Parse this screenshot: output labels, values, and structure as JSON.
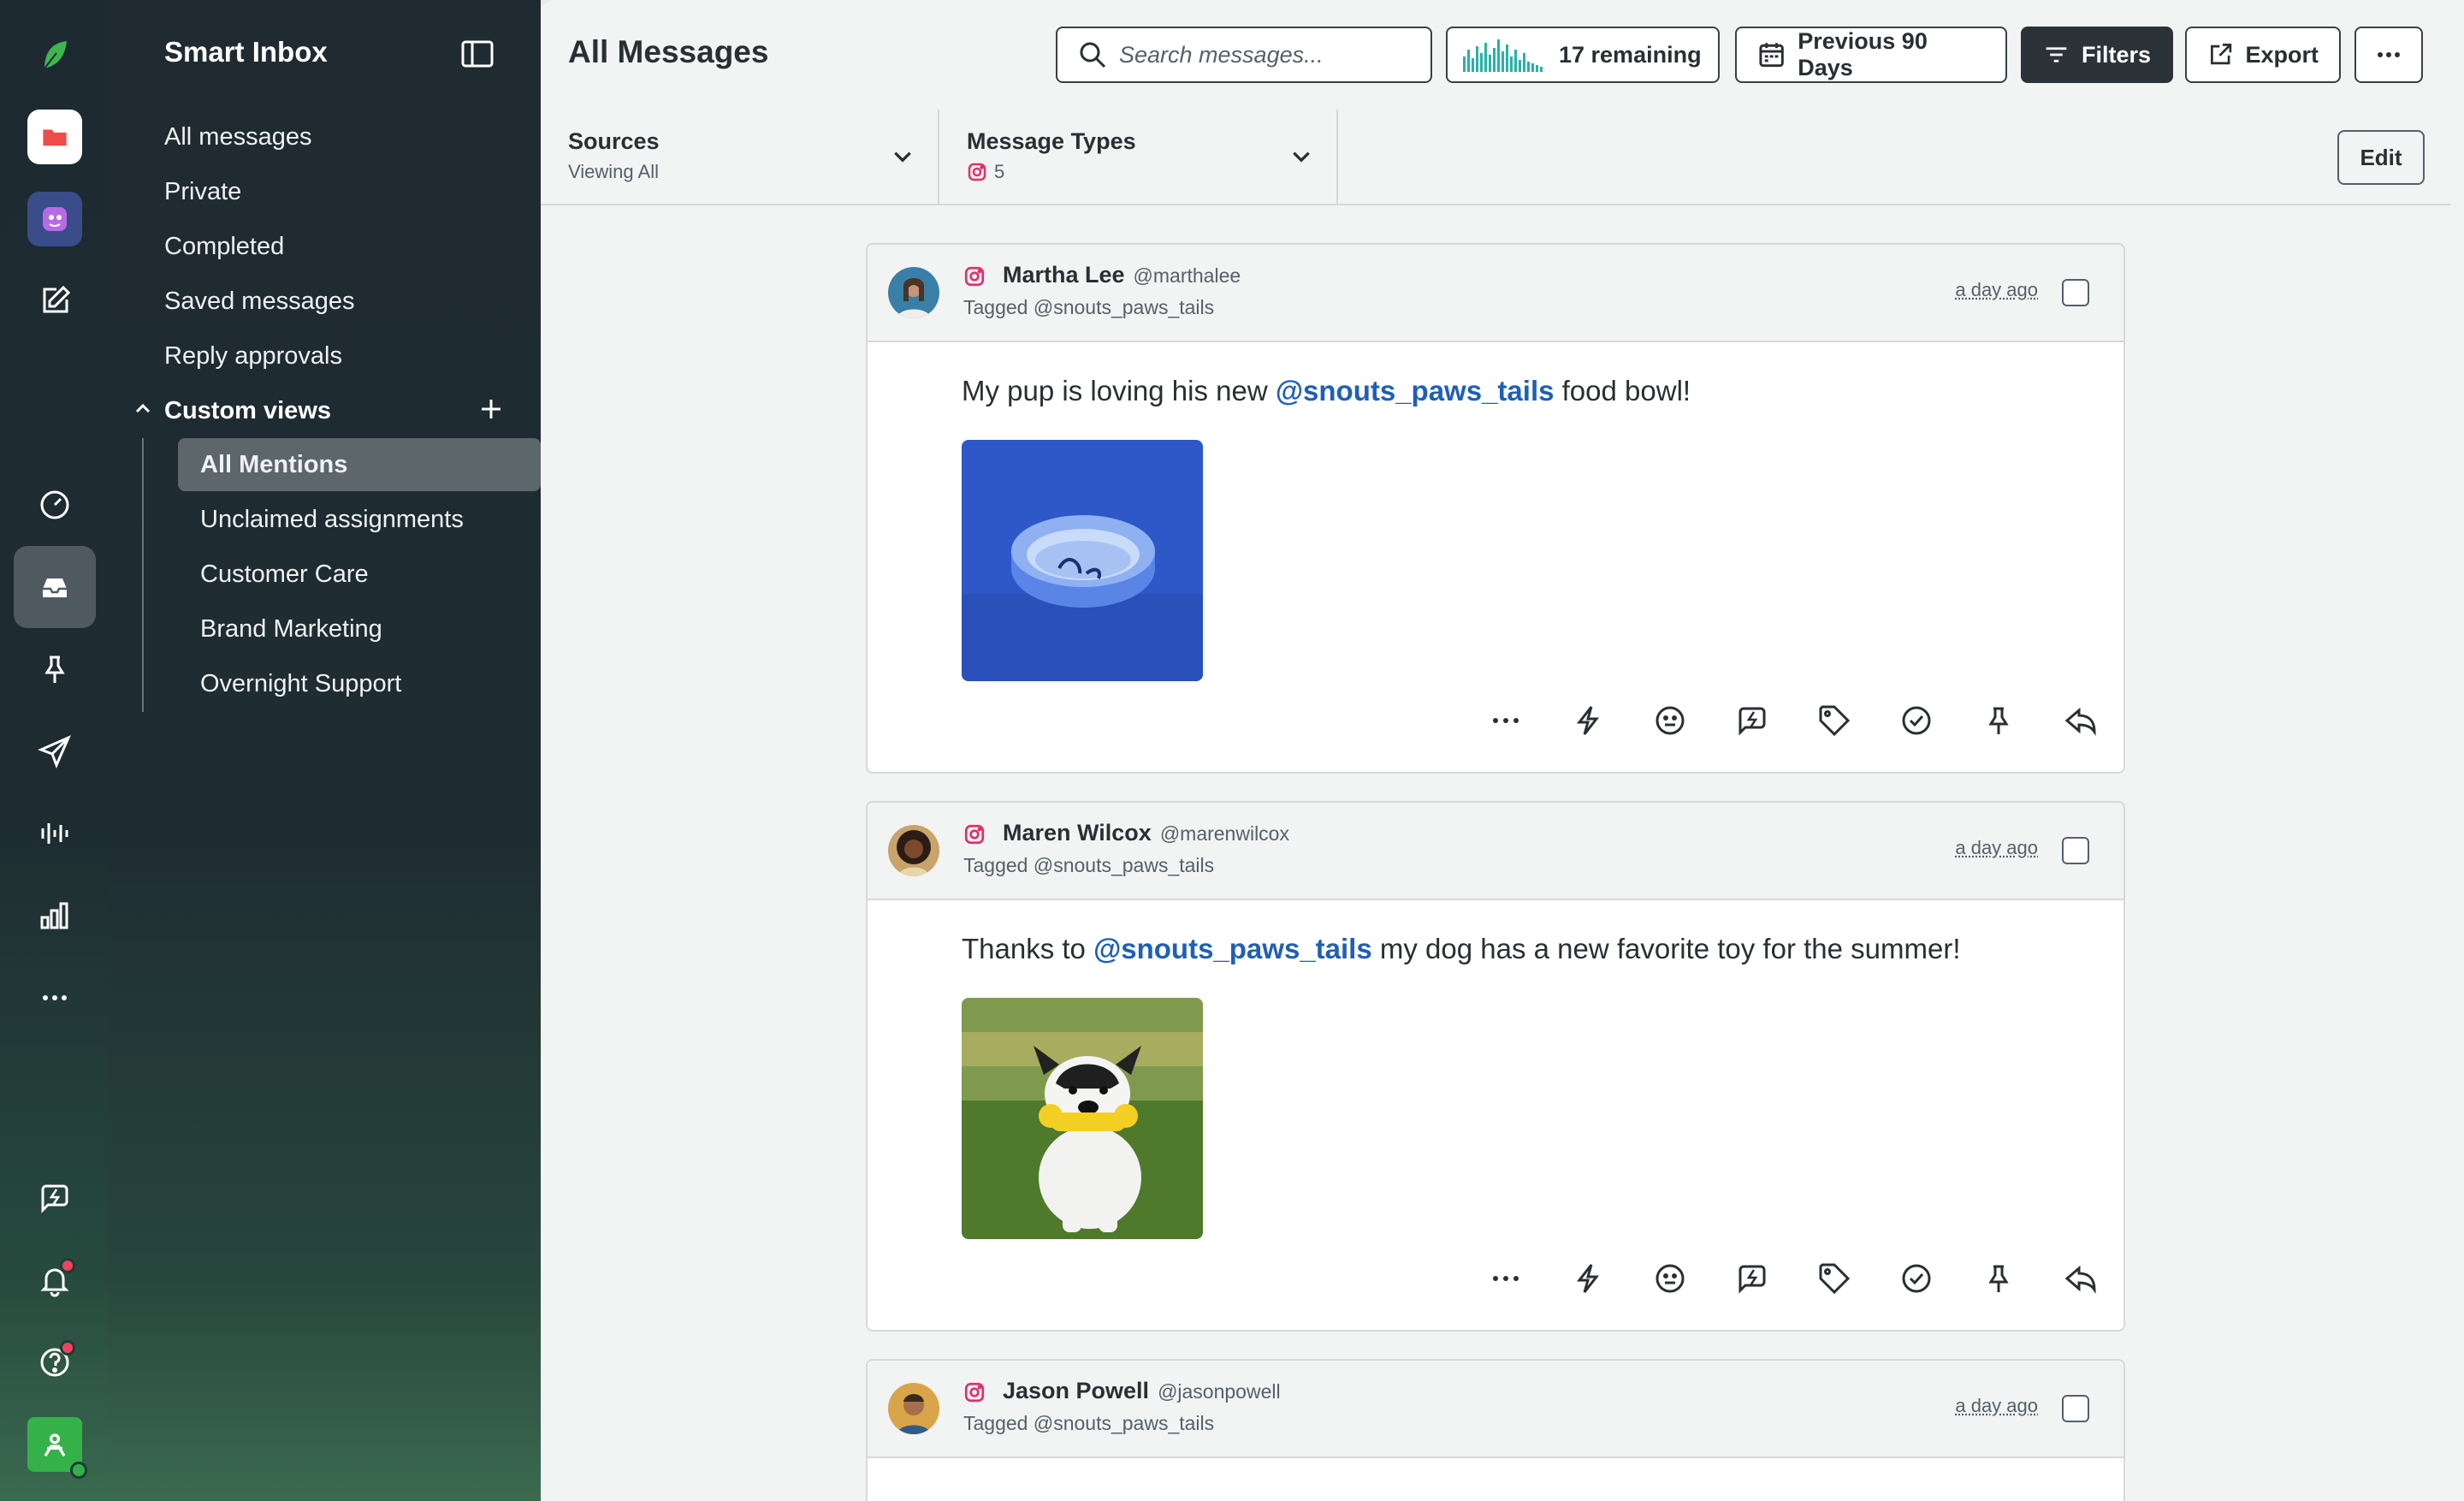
{
  "rail": {
    "icons": [
      "sprout-logo-icon",
      "folder-icon",
      "bot-avatar-icon",
      "compose-icon",
      "gauge-icon",
      "inbox-icon",
      "pin-icon",
      "send-icon",
      "listening-icon",
      "reports-icon",
      "more-icon",
      "feedback-icon",
      "bell-icon",
      "help-icon",
      "account-avatar-icon"
    ]
  },
  "sidebar": {
    "title": "Smart Inbox",
    "items": [
      "All messages",
      "Private",
      "Completed",
      "Saved messages",
      "Reply approvals"
    ],
    "custom_views_label": "Custom views",
    "custom_views": [
      "All Mentions",
      "Unclaimed assignments",
      "Customer Care",
      "Brand Marketing",
      "Overnight Support"
    ],
    "active_view": "All Mentions"
  },
  "header": {
    "title": "All Messages",
    "search_placeholder": "Search messages...",
    "remaining": "17 remaining",
    "date_range": "Previous 90 Days",
    "filters": "Filters",
    "export": "Export"
  },
  "filters": {
    "sources_label": "Sources",
    "sources_value": "Viewing All",
    "types_label": "Message Types",
    "types_count": "5",
    "edit": "Edit"
  },
  "messages": [
    {
      "name": "Martha Lee",
      "handle": "@marthalee",
      "tagged": "Tagged @snouts_paws_tails",
      "time": "a day ago",
      "pre": "My pup is loving his new ",
      "mention": "@snouts_paws_tails",
      "post": " food bowl!"
    },
    {
      "name": "Maren Wilcox",
      "handle": "@marenwilcox",
      "tagged": "Tagged @snouts_paws_tails",
      "time": "a day ago",
      "pre": "Thanks to ",
      "mention": "@snouts_paws_tails",
      "post": " my dog has a new favorite toy for the summer!"
    },
    {
      "name": "Jason Powell",
      "handle": "@jasonpowell",
      "tagged": "Tagged @snouts_paws_tails",
      "time": "a day ago"
    }
  ],
  "colors": {
    "accent": "#1f5fb6",
    "brand_green": "#35b14a",
    "instagram": "#e1306c",
    "notification": "#f0435c"
  }
}
